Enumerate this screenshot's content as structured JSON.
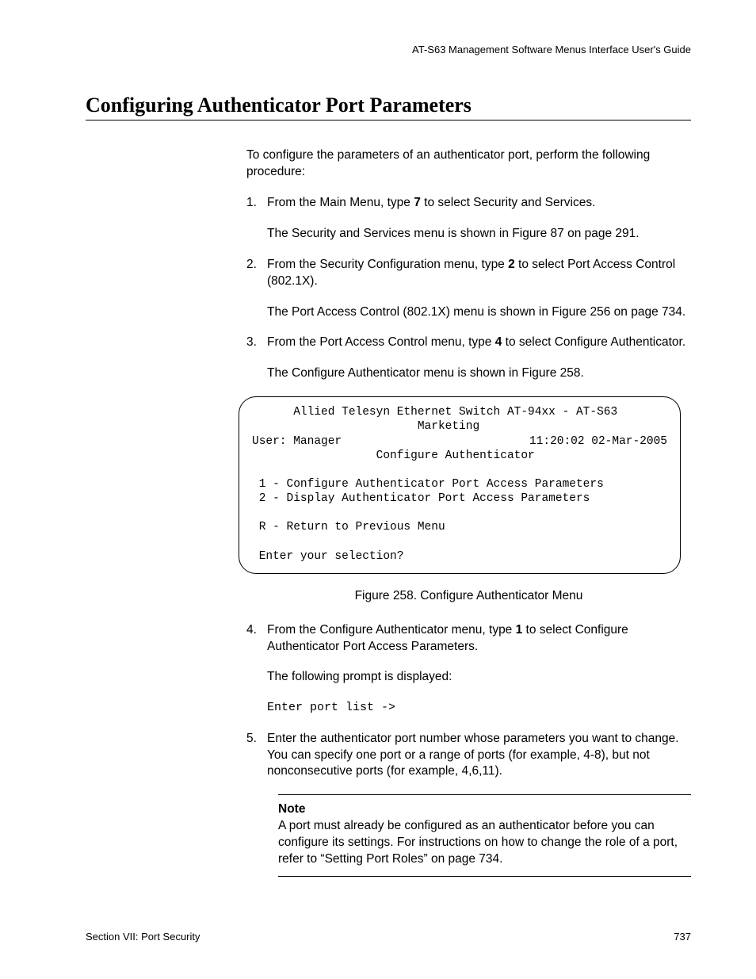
{
  "running_header": "AT-S63 Management Software Menus Interface User's Guide",
  "section_title": "Configuring Authenticator Port Parameters",
  "intro": "To configure the parameters of an authenticator port, perform the following procedure:",
  "steps": {
    "s1_num": "1.",
    "s1_a": "From the Main Menu, type ",
    "s1_bold": "7",
    "s1_b": " to select Security and Services.",
    "s1_follow": "The Security and Services menu is shown in Figure 87 on page 291.",
    "s2_num": "2.",
    "s2_a": "From the Security Configuration menu, type ",
    "s2_bold": "2",
    "s2_b": " to select Port Access Control (802.1X).",
    "s2_follow": "The Port Access Control (802.1X) menu is shown in Figure 256 on page 734.",
    "s3_num": "3.",
    "s3_a": "From the Port Access Control menu, type ",
    "s3_bold": "4",
    "s3_b": " to select Configure Authenticator.",
    "s3_follow": "The Configure Authenticator menu is shown in Figure 258.",
    "s4_num": "4.",
    "s4_a": "From the Configure Authenticator menu, type ",
    "s4_bold": "1",
    "s4_b": " to select Configure Authenticator Port Access Parameters.",
    "s4_follow": "The following prompt is displayed:",
    "s4_prompt": "Enter port list ->",
    "s5_num": "5.",
    "s5_text": "Enter the authenticator port number whose parameters you want to change. You can specify one port or a range of ports (for example, 4-8), but not nonconsecutive ports (for example, 4,6,11)."
  },
  "terminal": {
    "line1": "      Allied Telesyn Ethernet Switch AT-94xx - AT-S63",
    "line2": "                        Marketing",
    "line3_left": "User: Manager",
    "line3_right": "11:20:02 02-Mar-2005",
    "line4": "                  Configure Authenticator",
    "opt1": " 1 - Configure Authenticator Port Access Parameters",
    "opt2": " 2 - Display Authenticator Port Access Parameters",
    "optR": " R - Return to Previous Menu",
    "prompt": " Enter your selection?"
  },
  "figure_caption": "Figure 258. Configure Authenticator Menu",
  "note": {
    "label": "Note",
    "text": "A port must already be configured as an authenticator before you can configure its settings. For instructions on how to change the role of a port, refer to “Setting Port Roles” on page 734."
  },
  "footer": {
    "left": "Section VII: Port Security",
    "right": "737"
  }
}
